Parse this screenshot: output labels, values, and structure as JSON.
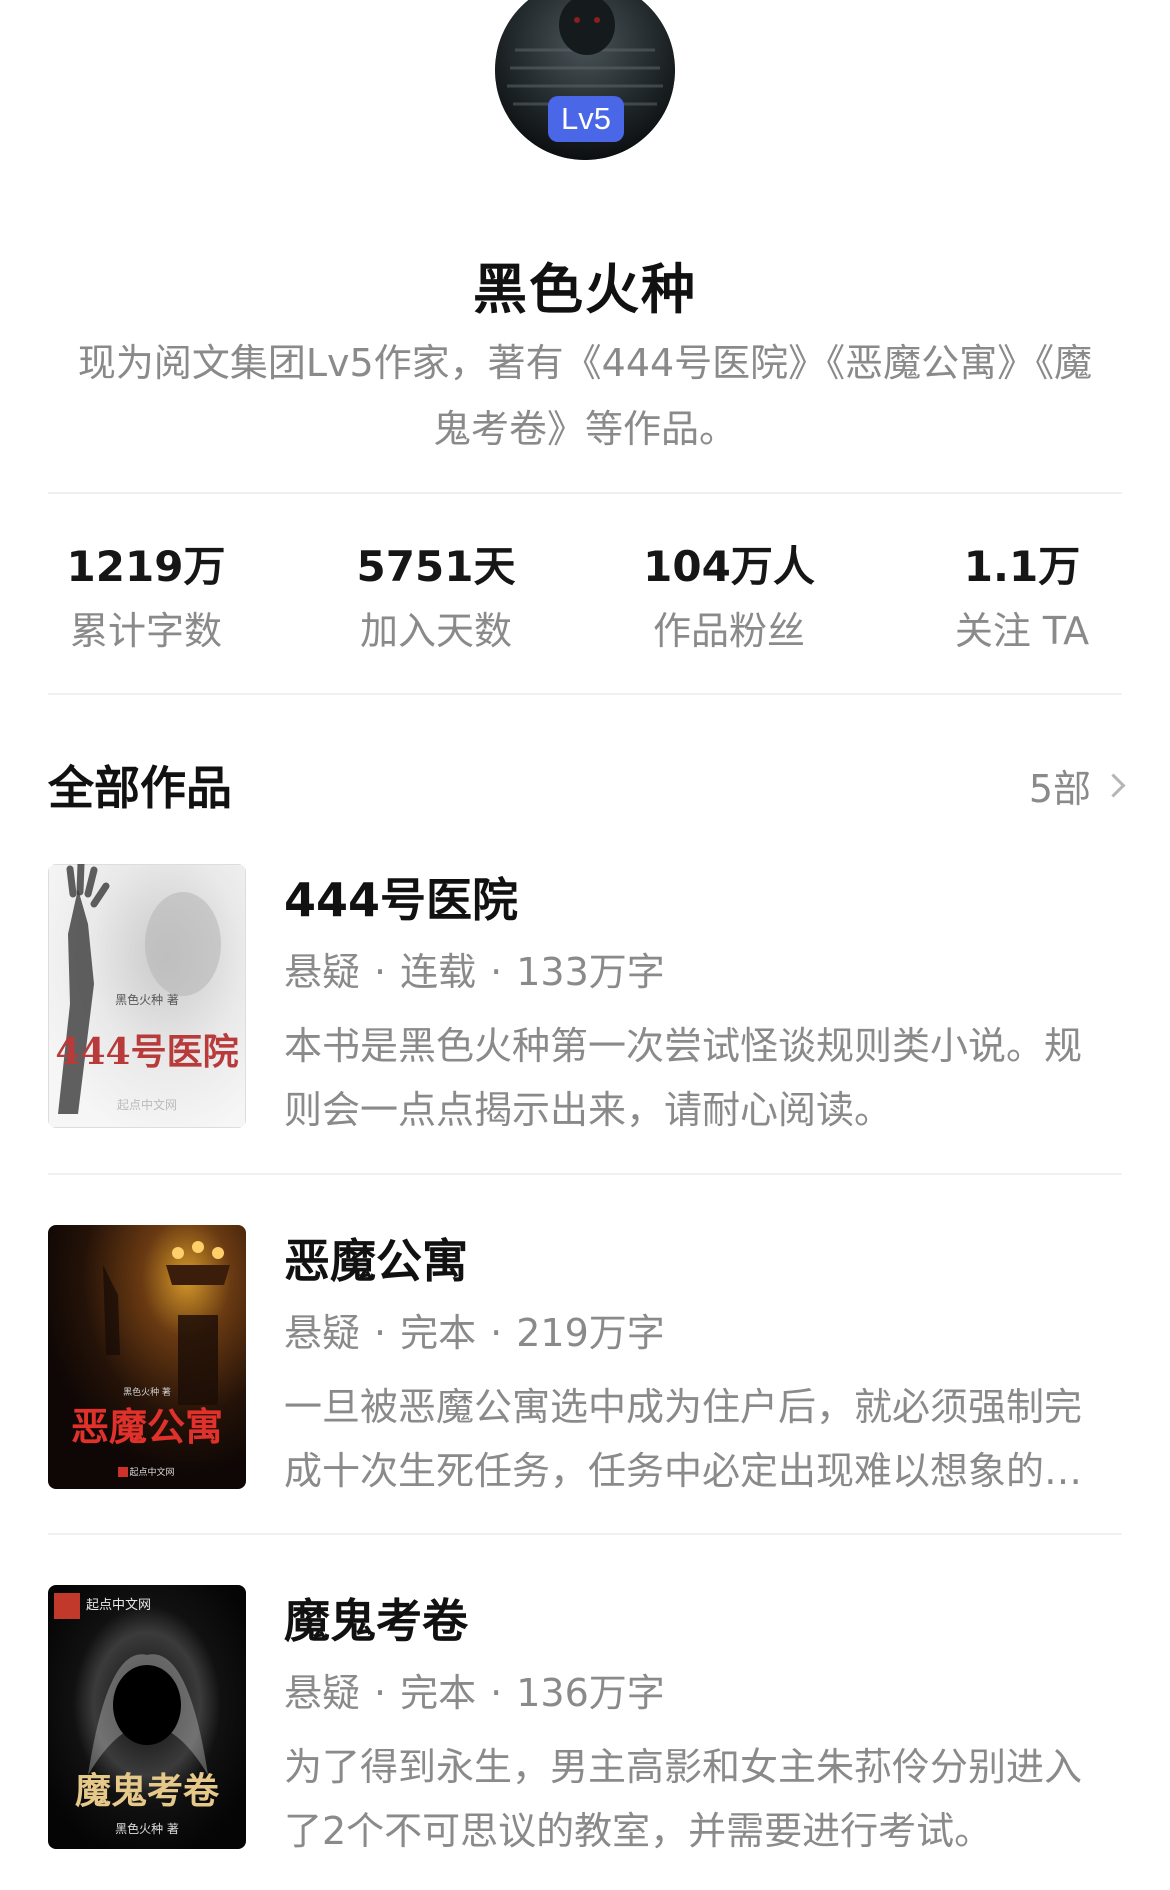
{
  "author": {
    "avatar_icon": "horror-avatar-image",
    "level_badge": "Lv5",
    "name": "黑色火种",
    "description": "现为阅文集团Lv5作家，著有《444号医院》《恶魔公寓》《魔鬼考卷》等作品。"
  },
  "stats": [
    {
      "value": "1219万",
      "label": "累计字数"
    },
    {
      "value": "5751天",
      "label": "加入天数"
    },
    {
      "value": "104万人",
      "label": "作品粉丝"
    },
    {
      "value": "1.1万",
      "label": "关注 TA"
    }
  ],
  "works_section": {
    "title": "全部作品",
    "count": "5部"
  },
  "works": [
    {
      "title": "444号医院",
      "genre": "悬疑",
      "status": "连载",
      "words": "133万字",
      "desc": "本书是黑色火种第一次尝试怪谈规则类小说。规则会一点点揭示出来，请耐心阅读。",
      "cover_text": "444号医院",
      "cover_author": "黑色火种 著",
      "cover_publisher": "起点中文网"
    },
    {
      "title": "恶魔公寓",
      "genre": "悬疑",
      "status": "完本",
      "words": "219万字",
      "desc": "一旦被恶魔公寓选中成为住户后，就必须强制完成十次生死任务，任务中必定出现难以想象的恐怖。",
      "cover_text": "恶魔公寓",
      "cover_author": "黑色火种 著",
      "cover_publisher": "起点中文网"
    },
    {
      "title": "魔鬼考卷",
      "genre": "悬疑",
      "status": "完本",
      "words": "136万字",
      "desc": "为了得到永生，男主高影和女主朱荪伶分别进入了2个不可思议的教室，并需要进行考试。",
      "cover_text": "魔鬼考卷",
      "cover_author": "黑色火种 著",
      "cover_publisher": "起点中文网"
    }
  ],
  "colors": {
    "badge": "#4a67e8",
    "text_primary": "#111111",
    "text_secondary": "#8a8a8a",
    "divider": "#f0f0f0"
  }
}
